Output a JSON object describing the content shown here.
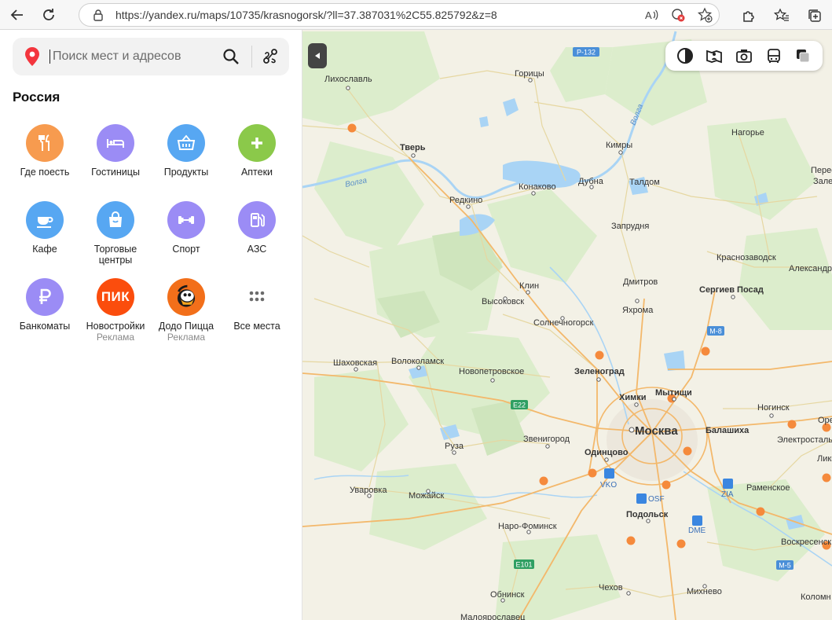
{
  "browser": {
    "url": "https://yandex.ru/maps/10735/krasnogorsk/?ll=37.387031%2C55.825792&z=8"
  },
  "search": {
    "placeholder": "Поиск мест и адресов"
  },
  "sidebar": {
    "region": "Россия",
    "categories": [
      {
        "label": "Где поесть",
        "icon": "fork-knife-icon",
        "color": "#f79b4f"
      },
      {
        "label": "Гостиницы",
        "icon": "bed-icon",
        "color": "#9b8cf5"
      },
      {
        "label": "Продукты",
        "icon": "basket-icon",
        "color": "#57a7f2"
      },
      {
        "label": "Аптеки",
        "icon": "plus-icon",
        "color": "#8bc94a"
      },
      {
        "label": "Кафе",
        "icon": "cup-icon",
        "color": "#57a7f2"
      },
      {
        "label": "Торговые центры",
        "icon": "bag-icon",
        "color": "#57a7f2"
      },
      {
        "label": "Спорт",
        "icon": "dumbbell-icon",
        "color": "#9b8cf5"
      },
      {
        "label": "АЗС",
        "icon": "fuel-icon",
        "color": "#9b8cf5"
      },
      {
        "label": "Банкоматы",
        "icon": "ruble-icon",
        "color": "#9b8cf5"
      },
      {
        "label": "Новостройки",
        "ad": "Реклама",
        "icon": "pik-logo",
        "logo_text": "ПИК",
        "color": "#fb4d0d"
      },
      {
        "label": "Додо Пицца",
        "ad": "Реклама",
        "icon": "dodo-logo",
        "color": "#f26f1a"
      },
      {
        "label": "Все места",
        "icon": "dots-grid-icon",
        "color": "#ffffff"
      }
    ]
  },
  "map": {
    "colors": {
      "land": "#f3f1e6",
      "forest": "#d9ecc9",
      "water": "#a9d4f5",
      "road_major": "#f3b86b",
      "road_minor": "#e8d9a6"
    },
    "road_badges": [
      {
        "text": "Р-132",
        "color": "#4a8fd8"
      },
      {
        "text": "М-8",
        "color": "#4a8fd8"
      },
      {
        "text": "E22",
        "color": "#2f9f62"
      },
      {
        "text": "E101",
        "color": "#2f9f62"
      },
      {
        "text": "М-5",
        "color": "#4a8fd8"
      }
    ],
    "river_labels": [
      "Волга",
      "Волга"
    ],
    "airports": [
      "VKO",
      "OSF",
      "ZIA",
      "DME"
    ],
    "cities": [
      {
        "name": "Лихославль"
      },
      {
        "name": "Горицы"
      },
      {
        "name": "Тверь",
        "bold": true
      },
      {
        "name": "Кимры"
      },
      {
        "name": "Нагорье"
      },
      {
        "name": "Пересл"
      },
      {
        "name": "Зале"
      },
      {
        "name": "Конаково"
      },
      {
        "name": "Дубна"
      },
      {
        "name": "Редкино"
      },
      {
        "name": "Талдом"
      },
      {
        "name": "Запрудня"
      },
      {
        "name": "Краснозаводск"
      },
      {
        "name": "Александр"
      },
      {
        "name": "Клин"
      },
      {
        "name": "Дмитров"
      },
      {
        "name": "Высоковск"
      },
      {
        "name": "Сергиев Посад",
        "bold": true
      },
      {
        "name": "Яхрома"
      },
      {
        "name": "Солнечногорск"
      },
      {
        "name": "Шаховская"
      },
      {
        "name": "Волоколамск"
      },
      {
        "name": "Новопетровское"
      },
      {
        "name": "Зеленоград",
        "bold": true
      },
      {
        "name": "Химки",
        "bold": true
      },
      {
        "name": "Мытищи",
        "bold": true
      },
      {
        "name": "Москва",
        "bold": true
      },
      {
        "name": "Балашиха",
        "bold": true
      },
      {
        "name": "Ногинск"
      },
      {
        "name": "Орех"
      },
      {
        "name": "Электросталь"
      },
      {
        "name": "Звенигород"
      },
      {
        "name": "Одинцово",
        "bold": true
      },
      {
        "name": "Руза"
      },
      {
        "name": "Ликин"
      },
      {
        "name": "Уваровка"
      },
      {
        "name": "Можайск"
      },
      {
        "name": "Раменское"
      },
      {
        "name": "Подольск",
        "bold": true
      },
      {
        "name": "Наро-Фоминск"
      },
      {
        "name": "Воскресенск"
      },
      {
        "name": "Чехов"
      },
      {
        "name": "Обнинск"
      },
      {
        "name": "Михнево"
      },
      {
        "name": "Коломн"
      },
      {
        "name": "Малоярославец"
      }
    ]
  }
}
